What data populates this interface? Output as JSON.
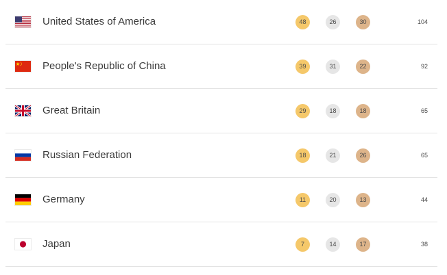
{
  "medal_table": {
    "rows": [
      {
        "country": "United States of America",
        "flag_icon": "usa-flag-icon",
        "gold": "48",
        "silver": "26",
        "bronze": "30",
        "total": "104"
      },
      {
        "country": "People's Republic of China",
        "flag_icon": "china-flag-icon",
        "gold": "39",
        "silver": "31",
        "bronze": "22",
        "total": "92"
      },
      {
        "country": "Great Britain",
        "flag_icon": "great-britain-flag-icon",
        "gold": "29",
        "silver": "18",
        "bronze": "18",
        "total": "65"
      },
      {
        "country": "Russian Federation",
        "flag_icon": "russia-flag-icon",
        "gold": "18",
        "silver": "21",
        "bronze": "26",
        "total": "65"
      },
      {
        "country": "Germany",
        "flag_icon": "germany-flag-icon",
        "gold": "11",
        "silver": "20",
        "bronze": "13",
        "total": "44"
      },
      {
        "country": "Japan",
        "flag_icon": "japan-flag-icon",
        "gold": "7",
        "silver": "14",
        "bronze": "17",
        "total": "38"
      }
    ]
  },
  "colors": {
    "gold": "#f5c86a",
    "silver": "#e6e6e6",
    "bronze": "#ddb48a",
    "divider": "#e3e3e3",
    "text": "#3a3a3a"
  }
}
